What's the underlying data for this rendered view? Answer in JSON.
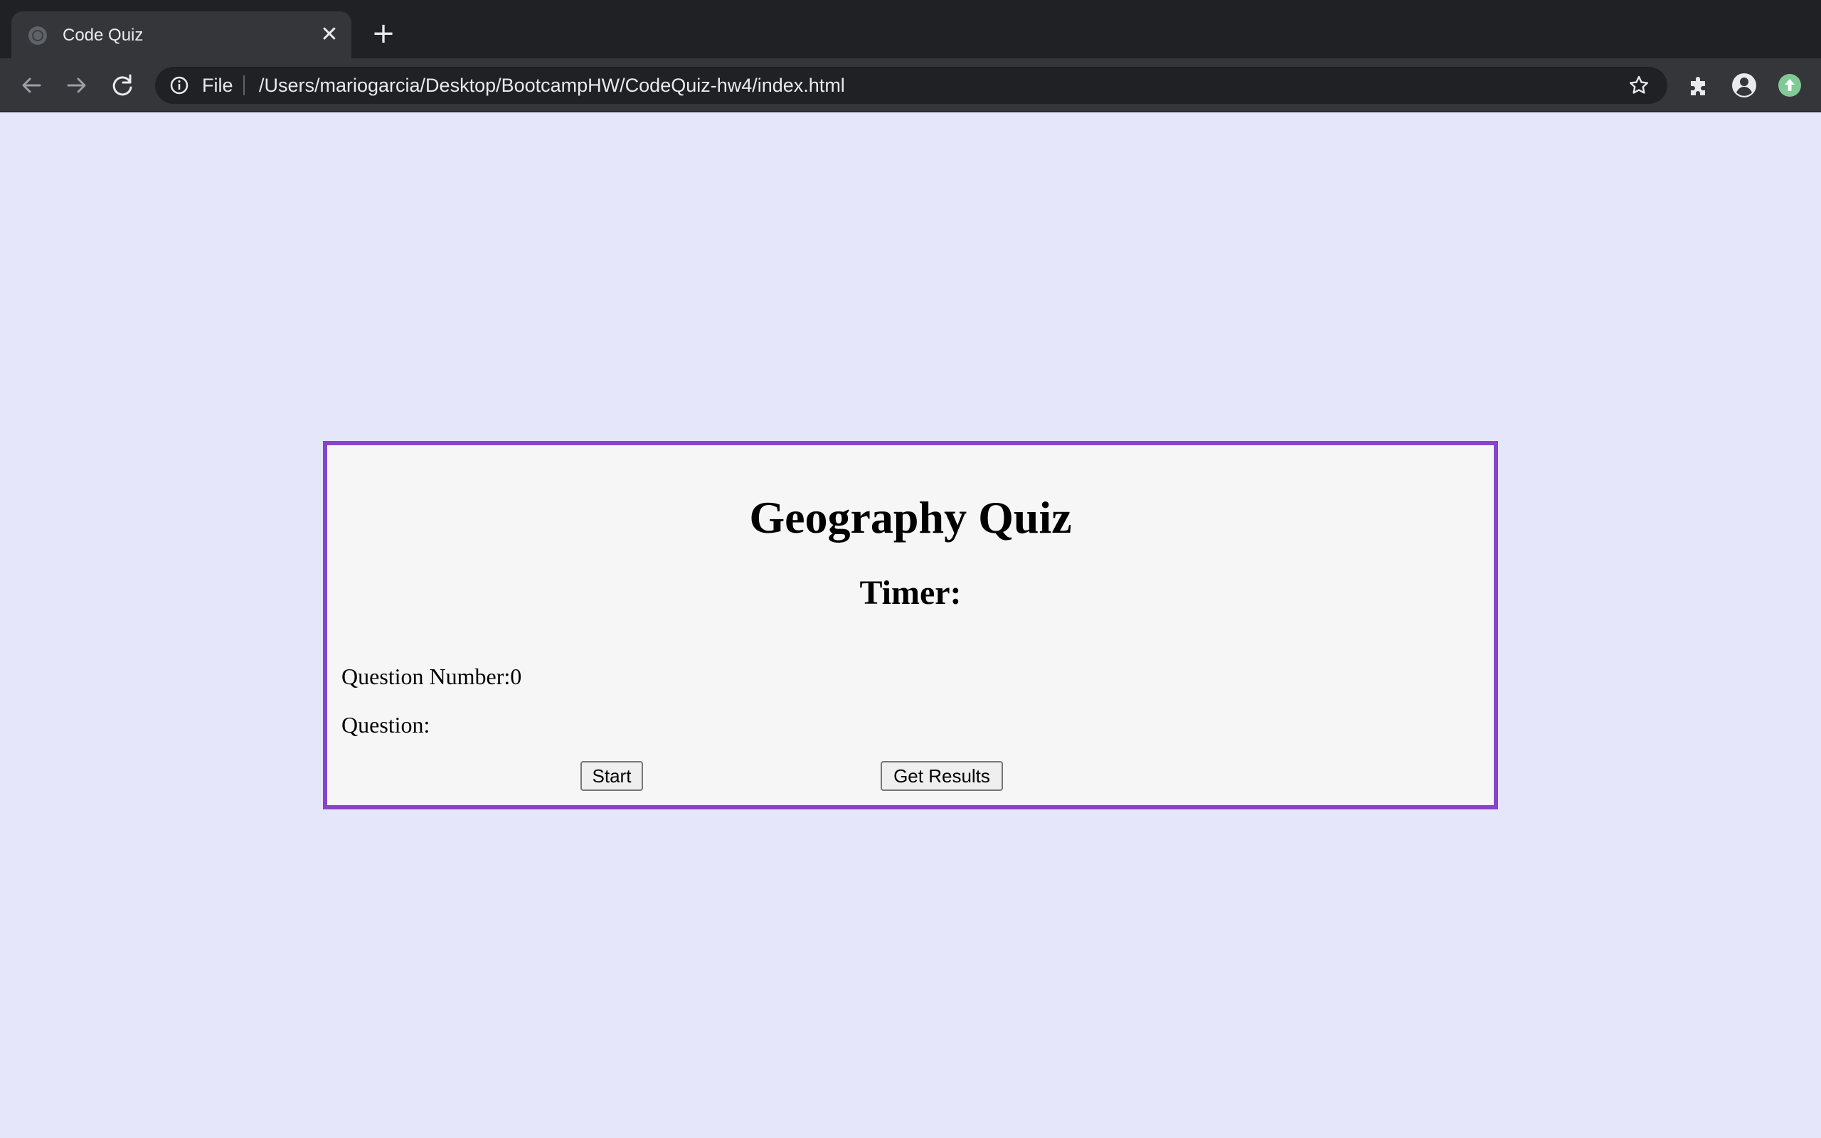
{
  "browser": {
    "tab": {
      "title": "Code Quiz",
      "close_glyph": "✕",
      "favicon": "globe-icon"
    },
    "new_tab_glyph": "+",
    "address_bar": {
      "scheme_label": "File",
      "url": "/Users/mariogarcia/Desktop/BootcampHW/CodeQuiz-hw4/index.html"
    },
    "icons": [
      "back-icon",
      "forward-icon",
      "reload-icon",
      "info-icon",
      "star-icon",
      "extensions-icon",
      "profile-icon",
      "update-icon"
    ]
  },
  "page": {
    "background": "#e6e6fa",
    "card_border_color": "#8844cc",
    "title": "Geography Quiz",
    "timer_label": "Timer:",
    "question_number_label": "Question Number:0",
    "question_label": "Question:",
    "buttons": {
      "start": "Start",
      "get_results": "Get Results"
    }
  }
}
